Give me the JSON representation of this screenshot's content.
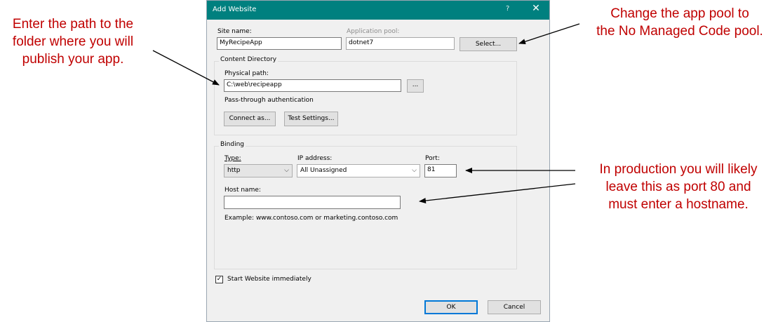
{
  "annotations": {
    "left": [
      "Enter the path to the",
      "folder where you will",
      "publish your app."
    ],
    "top_right": [
      "Change the app pool to",
      "the No Managed Code pool."
    ],
    "bottom_right": [
      "In production you will likely",
      "leave this as port 80 and",
      "must enter a hostname."
    ]
  },
  "dialog": {
    "title": "Add Website",
    "help": "?",
    "close": "✕",
    "site_name_label": "Site name:",
    "site_name_value": "MyRecipeApp",
    "app_pool_label": "Application pool:",
    "app_pool_value": "dotnet7",
    "select_button": "Select...",
    "content_group": "Content Directory",
    "physical_path_label": "Physical path:",
    "physical_path_value": "C:\\web\\recipeapp",
    "browse_button": "...",
    "pass_through": "Pass-through authentication",
    "connect_as_button": "Connect as...",
    "test_settings_button": "Test Settings...",
    "binding_group": "Binding",
    "type_label": "Type:",
    "type_value": "http",
    "ip_label": "IP address:",
    "ip_value": "All Unassigned",
    "port_label": "Port:",
    "port_value": "81",
    "host_label": "Host name:",
    "host_value": "",
    "example": "Example: www.contoso.com or marketing.contoso.com",
    "start_checkbox_label": "Start Website immediately",
    "start_checked": true,
    "ok_button": "OK",
    "cancel_button": "Cancel"
  },
  "colors": {
    "annotation": "#c00000",
    "titlebar": "#00807f",
    "dialog_bg": "#f0f0f0",
    "default_button_border": "#0078d7"
  }
}
